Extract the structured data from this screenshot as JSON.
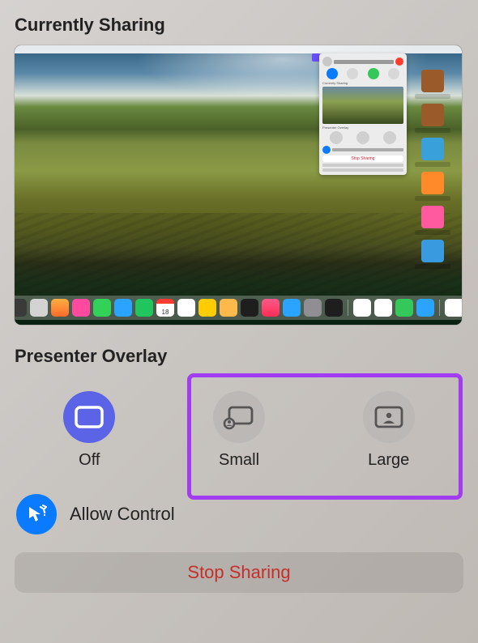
{
  "currently_sharing": {
    "title": "Currently Sharing"
  },
  "presenter_overlay": {
    "title": "Presenter Overlay",
    "options": [
      {
        "label": "Off",
        "selected": true
      },
      {
        "label": "Small",
        "selected": false
      },
      {
        "label": "Large",
        "selected": false
      }
    ]
  },
  "allow_control": {
    "label": "Allow Control"
  },
  "stop_sharing": {
    "label": "Stop Sharing"
  },
  "annotation": {
    "highlight_target": "small-and-large-options",
    "color": "#a23cf0"
  },
  "dock_colors": [
    "#2b6fb5",
    "#3a3a3a",
    "#d3d3d3",
    "#ff8a2a",
    "#ff4aa0",
    "#32d158",
    "#2aa4ff",
    "#21c55d",
    "#ff3a30",
    "#ffffff",
    "#ffcc00",
    "#ffb020",
    "#1e1e1e",
    "#ff2d55",
    "#2aa4ff",
    "#8e8e93",
    "#1e1e1e",
    "#ffffff",
    "#2aa4ff",
    "#ffb020",
    "#ffffff",
    "#34c759",
    "#2aa4ff",
    "#ffffff",
    "#ffffff",
    "#e8e8e8"
  ],
  "desktop_icon_colors": [
    "#9a5a2a",
    "#9a5a2a",
    "#3aa0da",
    "#ff8a2a",
    "#ff5aa0",
    "#3a9ae0"
  ]
}
